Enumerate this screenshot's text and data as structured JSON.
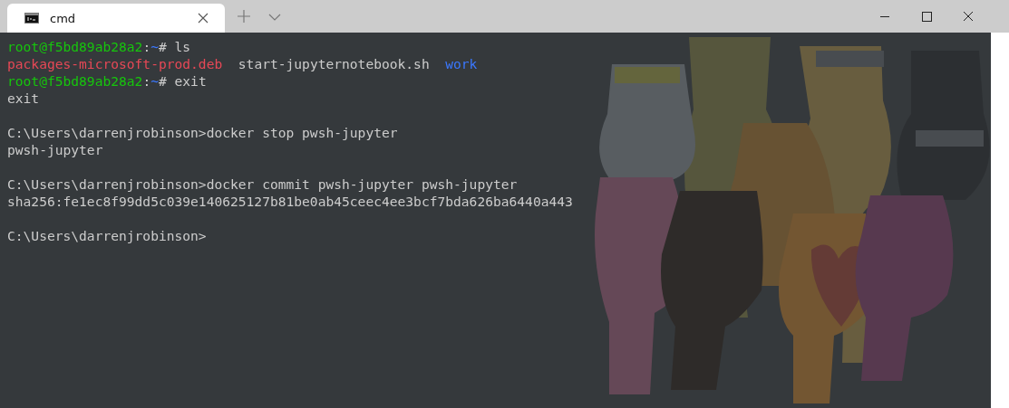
{
  "tabs": [
    {
      "title": "cmd",
      "selected": true
    }
  ],
  "terminal": {
    "blocks": [
      [
        {
          "segments": [
            {
              "text": "root@f5bd89ab28a2",
              "color": "#16c60c"
            },
            {
              "text": ":",
              "color": "#cccccc"
            },
            {
              "text": "~",
              "color": "#3b78ff"
            },
            {
              "text": "# ls",
              "color": "#cccccc"
            }
          ]
        },
        {
          "segments": [
            {
              "text": "packages-microsoft-prod.deb",
              "color": "#e74856"
            },
            {
              "text": "  start-jupyternotebook.sh  ",
              "color": "#cccccc"
            },
            {
              "text": "work",
              "color": "#3b78ff"
            }
          ]
        },
        {
          "segments": [
            {
              "text": "root@f5bd89ab28a2",
              "color": "#16c60c"
            },
            {
              "text": ":",
              "color": "#cccccc"
            },
            {
              "text": "~",
              "color": "#3b78ff"
            },
            {
              "text": "# exit",
              "color": "#cccccc"
            }
          ]
        },
        {
          "segments": [
            {
              "text": "exit",
              "color": "#cccccc"
            }
          ]
        }
      ],
      [
        {
          "segments": [
            {
              "text": "C:\\Users\\darrenjrobinson>docker stop pwsh-jupyter",
              "color": "#cccccc"
            }
          ]
        },
        {
          "segments": [
            {
              "text": "pwsh-jupyter",
              "color": "#cccccc"
            }
          ]
        }
      ],
      [
        {
          "segments": [
            {
              "text": "C:\\Users\\darrenjrobinson>docker commit pwsh-jupyter pwsh-jupyter",
              "color": "#cccccc"
            }
          ]
        },
        {
          "segments": [
            {
              "text": "sha256:fe1ec8f99dd5c039e140625127b81be0ab45ceec4ee3bcf7bda626ba6440a443",
              "color": "#cccccc"
            }
          ]
        }
      ],
      [
        {
          "segments": [
            {
              "text": "C:\\Users\\darrenjrobinson>",
              "color": "#cccccc"
            }
          ]
        }
      ]
    ]
  }
}
